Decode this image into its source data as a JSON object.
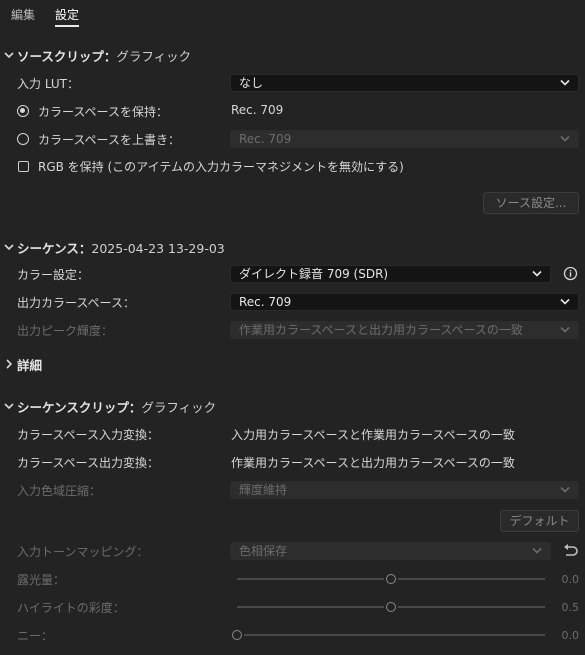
{
  "tabs": {
    "edit": "編集",
    "settings": "設定"
  },
  "source_clip": {
    "title": "ソースクリップ：",
    "value": "グラフィック",
    "input_lut_label": "入力 LUT：",
    "input_lut_value": "なし",
    "preserve_label": "カラースペースを保持：",
    "preserve_value": "Rec. 709",
    "override_label": "カラースペースを上書き：",
    "override_value": "Rec. 709",
    "rgb_checkbox_label": "RGB を保持 (このアイテムの入力カラーマネジメントを無効にする)",
    "source_settings_button": "ソース設定..."
  },
  "sequence": {
    "title": "シーケンス：",
    "value": "2025-04-23 13-29-03",
    "color_setting_label": "カラー設定：",
    "color_setting_value": "ダイレクト録音 709 (SDR)",
    "output_space_label": "出力カラースペース：",
    "output_space_value": "Rec. 709",
    "peak_label": "出力ピーク輝度：",
    "peak_value": "作業用カラースペースと出力用カラースペースの一致",
    "details": "詳細"
  },
  "sequence_clip": {
    "title": "シーケンスクリップ：",
    "value": "グラフィック",
    "input_transform_label": "カラースペース入力変換：",
    "input_transform_value": "入力用カラースペースと作業用カラースペースの一致",
    "output_transform_label": "カラースペース出力変換：",
    "output_transform_value": "作業用カラースペースと出力用カラースペースの一致",
    "gamut_label": "入力色域圧縮：",
    "gamut_value": "輝度維持",
    "default_button": "デフォルト",
    "tone_label": "入力トーンマッピング：",
    "tone_value": "色相保存",
    "exposure_label": "露光量：",
    "exposure_value": "0.0",
    "highlight_label": "ハイライトの彩度：",
    "highlight_value": "0.5",
    "knee_label": "ニー：",
    "knee_value": "0.0"
  },
  "sliders": {
    "exposure": 0.5,
    "highlight": 0.5,
    "knee": 0.0
  },
  "colors": {
    "background": "#232323",
    "dropdown": "#141414",
    "disabled": "#2d2d2d"
  }
}
